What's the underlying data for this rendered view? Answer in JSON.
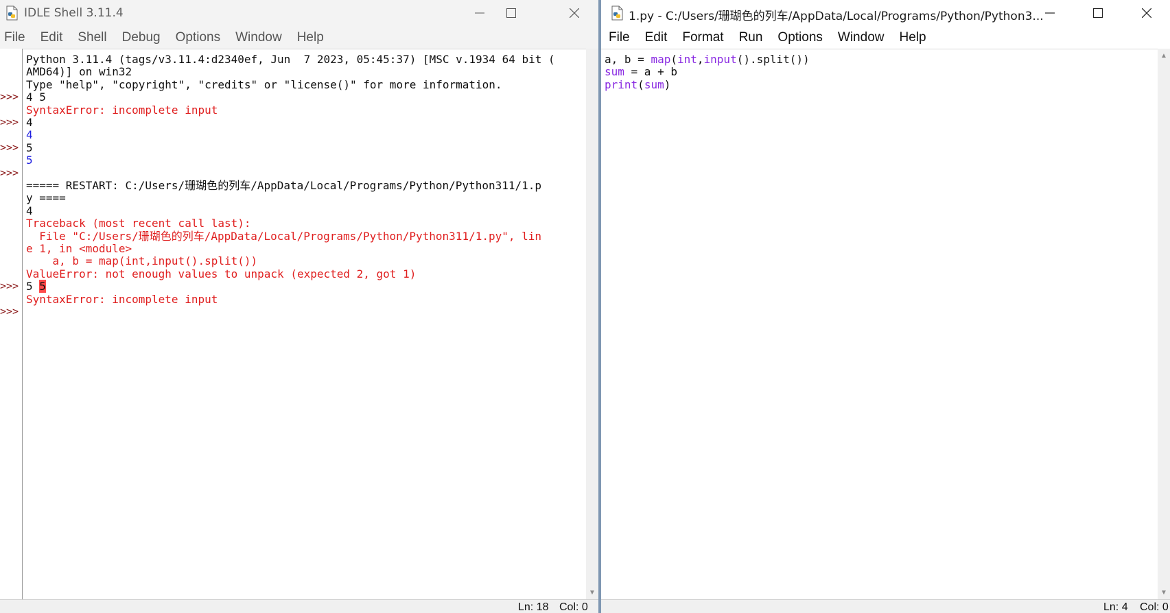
{
  "shell": {
    "title": "IDLE Shell 3.11.4",
    "menu": [
      "File",
      "Edit",
      "Shell",
      "Debug",
      "Options",
      "Window",
      "Help"
    ],
    "prompt": ">>>",
    "lines": [
      {
        "text": "Python 3.11.4 (tags/v3.11.4:d2340ef, Jun  7 2023, 05:45:37) [MSC v.1934 64 bit (",
        "color": "black",
        "prompt": false
      },
      {
        "text": "AMD64)] on win32",
        "color": "black",
        "prompt": false
      },
      {
        "text": "Type \"help\", \"copyright\", \"credits\" or \"license()\" for more information.",
        "color": "black",
        "prompt": false
      },
      {
        "text": "4 5",
        "color": "black",
        "prompt": true
      },
      {
        "text": "SyntaxError: incomplete input",
        "color": "red",
        "prompt": false
      },
      {
        "text": "4",
        "color": "black",
        "prompt": true
      },
      {
        "text": "4",
        "color": "blue",
        "prompt": false
      },
      {
        "text": "5",
        "color": "black",
        "prompt": true
      },
      {
        "text": "5",
        "color": "blue",
        "prompt": false
      },
      {
        "text": "",
        "color": "black",
        "prompt": true
      },
      {
        "text": "===== RESTART: C:/Users/珊瑚色的列车/AppData/Local/Programs/Python/Python311/1.p",
        "color": "black",
        "prompt": false
      },
      {
        "text": "y ====",
        "color": "black",
        "prompt": false
      },
      {
        "text": "4",
        "color": "black",
        "prompt": false
      },
      {
        "text": "Traceback (most recent call last):",
        "color": "red",
        "prompt": false
      },
      {
        "text": "  File \"C:/Users/珊瑚色的列车/AppData/Local/Programs/Python/Python311/1.py\", lin",
        "color": "red",
        "prompt": false
      },
      {
        "text": "e 1, in <module>",
        "color": "red",
        "prompt": false
      },
      {
        "text": "    a, b = map(int,input().split())",
        "color": "red",
        "prompt": false
      },
      {
        "text": "ValueError: not enough values to unpack (expected 2, got 1)",
        "color": "red",
        "prompt": false
      },
      {
        "text": "5 ",
        "color": "black",
        "prompt": true,
        "selected": "5"
      },
      {
        "text": "SyntaxError: incomplete input",
        "color": "red",
        "prompt": false
      },
      {
        "text": "",
        "color": "black",
        "prompt": true
      }
    ],
    "status": {
      "ln": "Ln: 18",
      "col": "Col: 0"
    }
  },
  "editor": {
    "title": "1.py - C:/Users/珊瑚色的列车/AppData/Local/Programs/Python/Python3...",
    "menu": [
      "File",
      "Edit",
      "Format",
      "Run",
      "Options",
      "Window",
      "Help"
    ],
    "code_lines": [
      [
        {
          "t": "a, b = ",
          "c": "black"
        },
        {
          "t": "map",
          "c": "purple"
        },
        {
          "t": "(",
          "c": "black"
        },
        {
          "t": "int",
          "c": "purple"
        },
        {
          "t": ",",
          "c": "black"
        },
        {
          "t": "input",
          "c": "purple"
        },
        {
          "t": "().split())",
          "c": "black"
        }
      ],
      [
        {
          "t": "sum",
          "c": "purple"
        },
        {
          "t": " = a + b",
          "c": "black"
        }
      ],
      [
        {
          "t": "print",
          "c": "purple"
        },
        {
          "t": "(",
          "c": "black"
        },
        {
          "t": "sum",
          "c": "purple"
        },
        {
          "t": ")",
          "c": "black"
        }
      ]
    ],
    "status": {
      "ln": "Ln: 4",
      "col": "Col: 0"
    }
  },
  "icons": {
    "app": "python-file-icon",
    "minimize": "minimize-icon",
    "maximize": "maximize-icon",
    "close": "close-icon",
    "scroll_up": "scroll-up-icon",
    "scroll_down": "scroll-down-icon"
  },
  "colors": {
    "error": "#e02020",
    "output": "#1f1fe0",
    "builtin": "#8a2be2",
    "prompt": "#8b1a1a",
    "separator": "#7f97b2"
  }
}
